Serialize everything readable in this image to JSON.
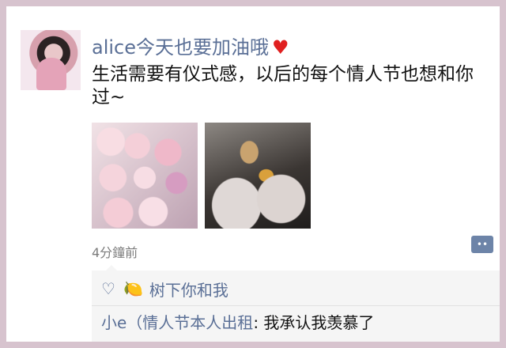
{
  "post": {
    "username": "alice今天也要加油哦",
    "heart_icon": "red-heart-icon",
    "text": "生活需要有仪式感，以后的每个情人节也想和你过~",
    "timestamp": "4分鐘前",
    "comment_button_icon": "comment-more-icon"
  },
  "images": [
    {
      "label": "roses"
    },
    {
      "label": "dinner"
    }
  ],
  "social": {
    "like_icon": "heart-outline-icon",
    "likes_user": "树下你和我",
    "comments": [
      {
        "user": "小e（情人节本人出租",
        "separator": ": ",
        "text": "我承认我羡慕了"
      }
    ]
  },
  "colors": {
    "name": "#5a6f96",
    "text": "#111111",
    "border": "#d7c3ce"
  }
}
